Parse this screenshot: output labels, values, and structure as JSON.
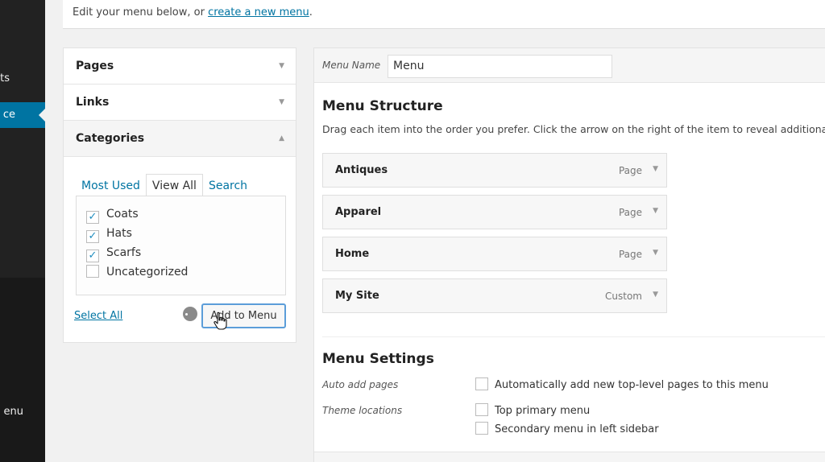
{
  "admin_sidebar": {
    "items": [
      {
        "label": "ts"
      },
      {
        "label": "ce"
      },
      {
        "label": "enu"
      }
    ]
  },
  "notice": {
    "text": "Edit your menu below, or ",
    "link": "create a new menu",
    "suffix": "."
  },
  "accordion": {
    "sections": [
      {
        "label": "Pages",
        "arrow": "▼"
      },
      {
        "label": "Links",
        "arrow": "▼"
      },
      {
        "label": "Categories",
        "arrow": "▲"
      }
    ],
    "tabs": [
      "Most Used",
      "View All",
      "Search"
    ],
    "active_tab": "View All",
    "categories": [
      {
        "label": "Coats",
        "checked": true
      },
      {
        "label": "Hats",
        "checked": true
      },
      {
        "label": "Scarfs",
        "checked": true
      },
      {
        "label": "Uncategorized",
        "checked": false
      }
    ],
    "select_all": "Select All",
    "add_button": "Add to Menu"
  },
  "menu": {
    "name_label": "Menu Name",
    "name_value": "Menu",
    "structure_title": "Menu Structure",
    "structure_desc": "Drag each item into the order you prefer. Click the arrow on the right of the item to reveal additional",
    "items": [
      {
        "title": "Antiques",
        "type": "Page"
      },
      {
        "title": "Apparel",
        "type": "Page"
      },
      {
        "title": "Home",
        "type": "Page"
      },
      {
        "title": "My Site",
        "type": "Custom"
      }
    ],
    "settings_title": "Menu Settings",
    "auto_add_label": "Auto add pages",
    "auto_add_option": "Automatically add new top-level pages to this menu",
    "theme_locations_label": "Theme locations",
    "theme_locations": [
      "Top primary menu",
      "Secondary menu in left sidebar"
    ]
  },
  "colors": {
    "accent": "#0074a2",
    "sidebar": "#222222"
  }
}
